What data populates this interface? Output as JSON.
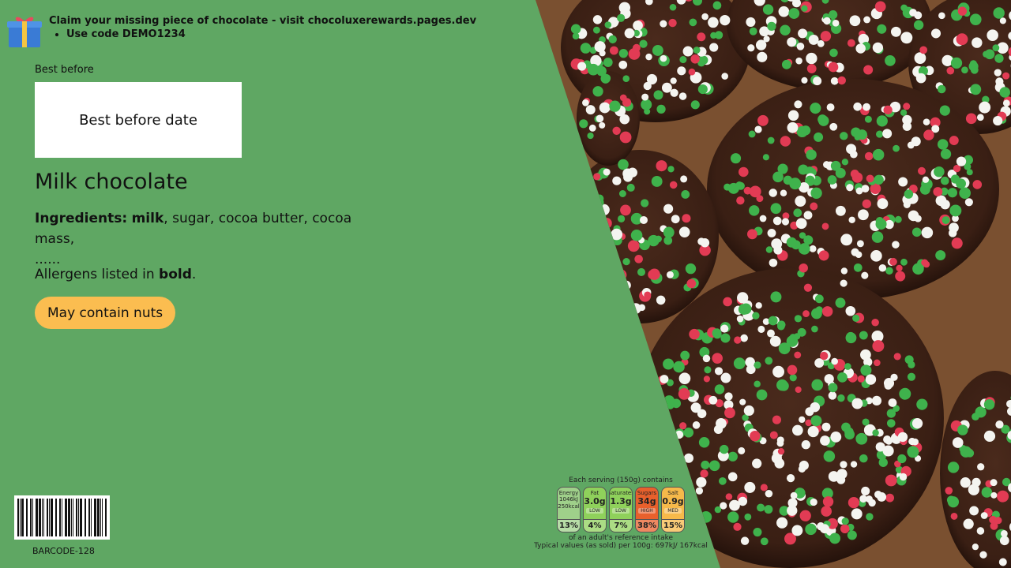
{
  "banner": {
    "headline": "Claim your missing piece of chocolate - visit chocoluxerewards.pages.dev",
    "bullet": "Use code DEMO1234"
  },
  "best_before": {
    "label": "Best before",
    "box_text": "Best before date"
  },
  "product": {
    "title": "Milk chocolate",
    "ingredients_label": "Ingredients:",
    "ingredients_bold": "milk",
    "ingredients_rest": ", sugar, cocoa butter, cocoa mass,",
    "ingredients_more": "......",
    "allergen_prefix": "Allergens listed in",
    "allergen_bold": "bold",
    "allergen_suffix": ".",
    "nuts_button": "May contain nuts"
  },
  "barcode": {
    "label": "BARCODE-128"
  },
  "nutrition": {
    "caption": "Each serving (150g) contains",
    "footer1": "of an adult's reference intake",
    "footer2": "Typical values (as sold) per 100g: 697kJ/ 167kcal",
    "items": [
      {
        "name": "Energy",
        "amount": "1046kJ 250kcal",
        "level": "",
        "percent": "13%",
        "color": "#9fd08a"
      },
      {
        "name": "Fat",
        "amount": "3.0g",
        "level": "LOW",
        "percent": "4%",
        "color": "#8fd15b"
      },
      {
        "name": "Saturates",
        "amount": "1.3g",
        "level": "LOW",
        "percent": "7%",
        "color": "#8fd15b"
      },
      {
        "name": "Sugars",
        "amount": "34g",
        "level": "HIGH",
        "percent": "38%",
        "color": "#e8602c"
      },
      {
        "name": "Salt",
        "amount": "0.9g",
        "level": "MED",
        "percent": "15%",
        "color": "#f6b94a"
      }
    ]
  },
  "colors": {
    "panel_green": "#5fa763",
    "button_orange": "#fbbd50",
    "photo_chocolate": "#3a1f14"
  }
}
